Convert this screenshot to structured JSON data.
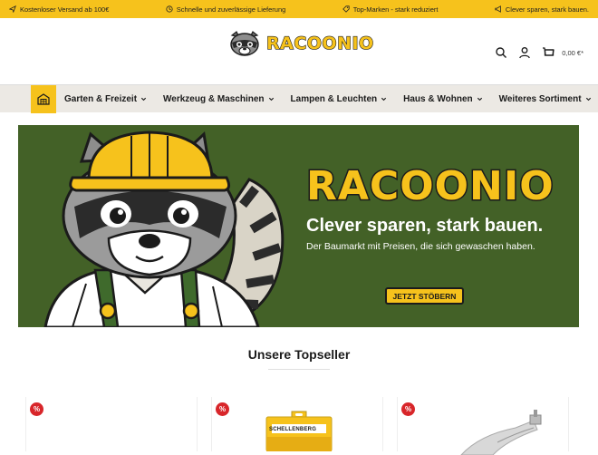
{
  "topbar": {
    "usps": [
      {
        "icon": "paper-plane-icon",
        "label": "Kostenloser Versand ab 100€"
      },
      {
        "icon": "clock-icon",
        "label": "Schnelle und zuverlässige Lieferung"
      },
      {
        "icon": "tag-icon",
        "label": "Top-Marken - stark reduziert"
      },
      {
        "icon": "megaphone-icon",
        "label": "Clever sparen, stark bauen."
      }
    ]
  },
  "header": {
    "logo_text": "RACOONIO",
    "cart_total": "0,00 €*"
  },
  "nav": {
    "items": [
      {
        "label": "Garten & Freizeit"
      },
      {
        "label": "Werkzeug & Maschinen"
      },
      {
        "label": "Lampen & Leuchten"
      },
      {
        "label": "Haus & Wohnen"
      },
      {
        "label": "Weiteres Sortiment"
      }
    ]
  },
  "hero": {
    "brand": "RACOONIO",
    "claim": "Clever sparen, stark bauen.",
    "subline": "Der Baumarkt mit Preisen, die sich gewaschen haben.",
    "cta": "JETZT STÖBERN"
  },
  "topseller": {
    "title": "Unsere Topseller",
    "products": [
      {
        "badge": "%"
      },
      {
        "badge": "%",
        "brand_label": "SCHELLENBERG"
      },
      {
        "badge": "%"
      }
    ]
  },
  "colors": {
    "accent": "#f6c21c",
    "hero_bg": "#436127",
    "nav_bg": "#ece9e4",
    "sale": "#d8262a"
  }
}
